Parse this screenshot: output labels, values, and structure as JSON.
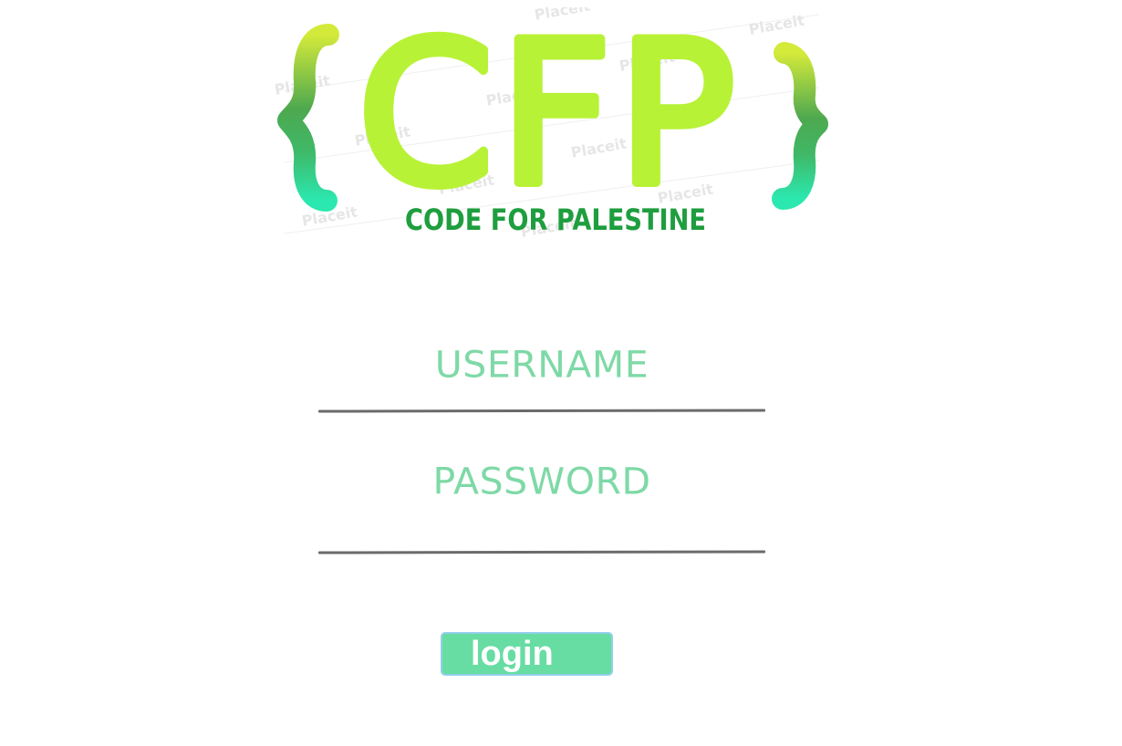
{
  "logo": {
    "letters": "CFP",
    "tagline": "CODE FOR PALESTINE",
    "watermark_text": "Placeit",
    "colors": {
      "letters": "#b8f236",
      "tagline": "#1e9e3e",
      "brace_top": "#d4ea3a",
      "brace_mid": "#4da84f",
      "brace_bottom": "#2be8b0"
    }
  },
  "form": {
    "username": {
      "label": "USERNAME",
      "value": ""
    },
    "password": {
      "label": "PASSWORD",
      "value": ""
    },
    "login_label": "login"
  },
  "colors": {
    "label_text": "#7ed9a6",
    "underline": "#6b6b6b",
    "button_fill": "#67dca3",
    "button_border": "#93cfea"
  }
}
